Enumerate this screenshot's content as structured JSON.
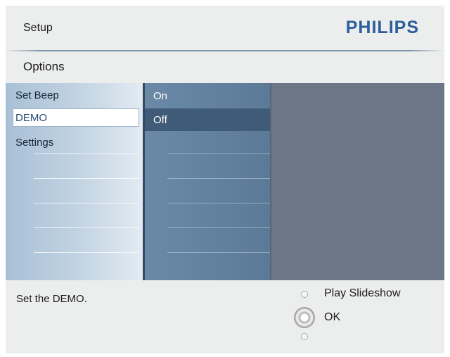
{
  "header": {
    "title": "Setup",
    "brand": "PHILIPS",
    "subtitle": "Options"
  },
  "menu": {
    "items": [
      {
        "label": "Set Beep"
      },
      {
        "label": "DEMO",
        "selected": true
      },
      {
        "label": "Settings"
      }
    ]
  },
  "options": {
    "items": [
      {
        "label": "On"
      },
      {
        "label": "Off",
        "selected": true
      }
    ]
  },
  "footer": {
    "hint": "Set the DEMO.",
    "nav": [
      {
        "label": "Play Slideshow",
        "icon": "nav-up-circle-icon"
      },
      {
        "label": "OK",
        "icon": "ok-button-icon"
      }
    ]
  },
  "colors": {
    "brand": "#2c5e9d",
    "panel_right": "#6b7687",
    "selected_option": "#3f5b77"
  }
}
